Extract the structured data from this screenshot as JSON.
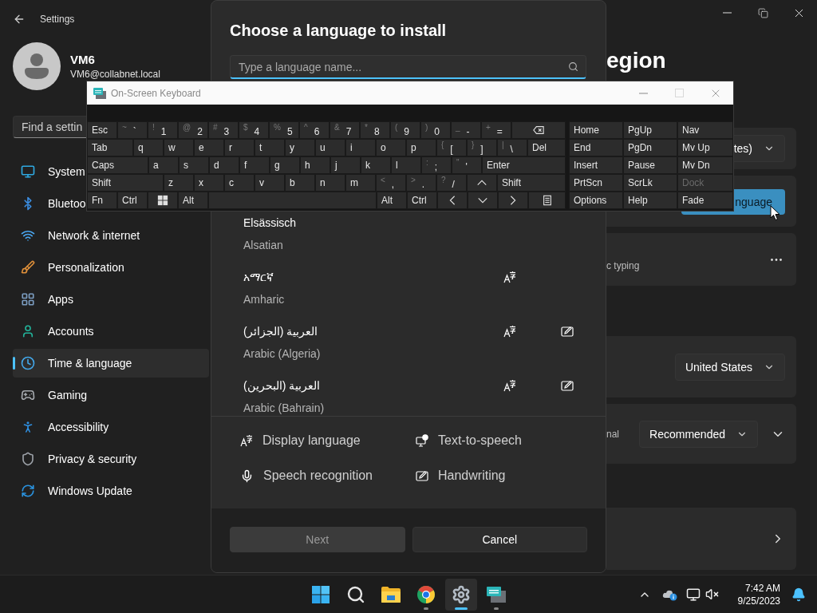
{
  "settings": {
    "title": "Settings",
    "user": {
      "name": "VM6",
      "email": "VM6@collabnet.local"
    },
    "search": {
      "placeholder": "Find a settin"
    },
    "nav": [
      {
        "label": "System",
        "kind": "system",
        "selected": false
      },
      {
        "label": "Bluetoo",
        "kind": "bluetooth",
        "selected": false
      },
      {
        "label": "Network & internet",
        "kind": "network",
        "selected": false
      },
      {
        "label": "Personalization",
        "kind": "personalization",
        "selected": false
      },
      {
        "label": "Apps",
        "kind": "apps",
        "selected": false
      },
      {
        "label": "Accounts",
        "kind": "accounts",
        "selected": false
      },
      {
        "label": "Time & language",
        "kind": "time",
        "selected": true
      },
      {
        "label": "Gaming",
        "kind": "gaming",
        "selected": false
      },
      {
        "label": "Accessibility",
        "kind": "accessibility",
        "selected": false
      },
      {
        "label": "Privacy & security",
        "kind": "privacy",
        "selected": false
      },
      {
        "label": "Windows Update",
        "kind": "update",
        "selected": false
      }
    ],
    "content": {
      "title": "egion",
      "sections": [
        {
          "cards": [
            {
              "kind": "dropdown",
              "value": "tes)"
            },
            {
              "kind": "button",
              "label": "nguage"
            },
            {
              "kind": "more",
              "description": "c typing"
            }
          ]
        },
        {
          "cards": [
            {
              "kind": "dropdown",
              "value": "United States"
            },
            {
              "kind": "dropdown",
              "value": "Recommended",
              "description": "nal",
              "expanded": false
            }
          ]
        },
        {
          "cards": [
            {
              "kind": "link"
            }
          ]
        }
      ]
    }
  },
  "dialog": {
    "title": "Choose a language to install",
    "search": {
      "placeholder": "Type a language name..."
    },
    "languages": [
      {
        "name": "Elsässisch",
        "english": "Alsatian",
        "display_language": false,
        "handwriting": false
      },
      {
        "name": "አማርኛ",
        "english": "Amharic",
        "display_language": true,
        "handwriting": false
      },
      {
        "name": "العربية (الجزائر)",
        "english": "Arabic (Algeria)",
        "display_language": true,
        "handwriting": true
      },
      {
        "name": "العربية (البحرين)",
        "english": "Arabic (Bahrain)",
        "display_language": true,
        "handwriting": true
      }
    ],
    "legend": [
      {
        "kind": "display",
        "label": "Display language"
      },
      {
        "kind": "tts",
        "label": "Text-to-speech"
      },
      {
        "kind": "speech",
        "label": "Speech recognition"
      },
      {
        "kind": "handwriting",
        "label": "Handwriting"
      }
    ],
    "buttons": [
      {
        "label": "Next",
        "disabled": true
      },
      {
        "label": "Cancel",
        "disabled": false
      }
    ]
  },
  "keyboard": {
    "title": "On-Screen Keyboard",
    "rows": [
      {
        "keys": [
          {
            "kind": "key",
            "label": "Esc"
          },
          {
            "kind": "key",
            "shift": "~",
            "label": "`"
          },
          {
            "kind": "key",
            "shift": "!",
            "label": "1"
          },
          {
            "kind": "key",
            "shift": "@",
            "label": "2"
          },
          {
            "kind": "key",
            "shift": "#",
            "label": "3"
          },
          {
            "kind": "key",
            "shift": "$",
            "label": "4"
          },
          {
            "kind": "key",
            "shift": "%",
            "label": "5"
          },
          {
            "kind": "key",
            "shift": "^",
            "label": "6"
          },
          {
            "kind": "key",
            "shift": "&",
            "label": "7"
          },
          {
            "kind": "key",
            "shift": "*",
            "label": "8"
          },
          {
            "kind": "key",
            "shift": "(",
            "label": "9"
          },
          {
            "kind": "key",
            "shift": ")",
            "label": "0"
          },
          {
            "kind": "key",
            "shift": "_",
            "label": "-"
          },
          {
            "kind": "key",
            "shift": "+",
            "label": "="
          },
          {
            "kind": "backspace"
          }
        ]
      },
      {
        "keys": [
          {
            "kind": "tab",
            "label": "Tab"
          },
          {
            "kind": "key",
            "label": "q"
          },
          {
            "kind": "key",
            "label": "w"
          },
          {
            "kind": "key",
            "label": "e"
          },
          {
            "kind": "key",
            "label": "r"
          },
          {
            "kind": "key",
            "label": "t"
          },
          {
            "kind": "key",
            "label": "y"
          },
          {
            "kind": "key",
            "label": "u"
          },
          {
            "kind": "key",
            "label": "i"
          },
          {
            "kind": "key",
            "label": "o"
          },
          {
            "kind": "key",
            "label": "p"
          },
          {
            "kind": "key",
            "shift": "{",
            "label": "["
          },
          {
            "kind": "key",
            "shift": "}",
            "label": "]"
          },
          {
            "kind": "key",
            "shift": "|",
            "label": "\\"
          },
          {
            "kind": "wide",
            "label": "Del"
          }
        ]
      },
      {
        "keys": [
          {
            "kind": "caps",
            "label": "Caps"
          },
          {
            "kind": "key",
            "label": "a"
          },
          {
            "kind": "key",
            "label": "s"
          },
          {
            "kind": "key",
            "label": "d"
          },
          {
            "kind": "key",
            "label": "f"
          },
          {
            "kind": "key",
            "label": "g"
          },
          {
            "kind": "key",
            "label": "h"
          },
          {
            "kind": "key",
            "label": "j"
          },
          {
            "kind": "key",
            "label": "k"
          },
          {
            "kind": "key",
            "label": "l"
          },
          {
            "kind": "key",
            "shift": ":",
            "label": ";"
          },
          {
            "kind": "key",
            "shift": "\"",
            "label": "'"
          },
          {
            "kind": "wide",
            "label": "Enter"
          }
        ]
      },
      {
        "keys": [
          {
            "kind": "shift",
            "label": "Shift"
          },
          {
            "kind": "key",
            "label": "z"
          },
          {
            "kind": "key",
            "label": "x"
          },
          {
            "kind": "key",
            "label": "c"
          },
          {
            "kind": "key",
            "label": "v"
          },
          {
            "kind": "key",
            "label": "b"
          },
          {
            "kind": "key",
            "label": "n"
          },
          {
            "kind": "key",
            "label": "m"
          },
          {
            "kind": "key",
            "shift": "<",
            "label": ","
          },
          {
            "kind": "key",
            "shift": ">",
            "label": "."
          },
          {
            "kind": "key",
            "shift": "?",
            "label": "/"
          },
          {
            "kind": "up"
          },
          {
            "kind": "wide",
            "label": "Shift"
          }
        ]
      },
      {
        "keys": [
          {
            "kind": "key",
            "label": "Fn"
          },
          {
            "kind": "key",
            "label": "Ctrl"
          },
          {
            "kind": "windows"
          },
          {
            "kind": "key",
            "label": "Alt"
          },
          {
            "kind": "space"
          },
          {
            "kind": "key",
            "label": "Alt"
          },
          {
            "kind": "key",
            "label": "Ctrl"
          },
          {
            "kind": "left"
          },
          {
            "kind": "down"
          },
          {
            "kind": "right"
          },
          {
            "kind": "menu"
          }
        ]
      }
    ],
    "nav_keys": [
      {
        "label": "Home",
        "disabled": false
      },
      {
        "label": "PgUp",
        "disabled": false
      },
      {
        "label": "Nav",
        "disabled": false
      },
      {
        "label": "End",
        "disabled": false
      },
      {
        "label": "PgDn",
        "disabled": false
      },
      {
        "label": "Mv Up",
        "disabled": false
      },
      {
        "label": "Insert",
        "disabled": false
      },
      {
        "label": "Pause",
        "disabled": false
      },
      {
        "label": "Mv Dn",
        "disabled": false
      },
      {
        "label": "PrtScn",
        "disabled": false
      },
      {
        "label": "ScrLk",
        "disabled": false
      },
      {
        "label": "Dock",
        "disabled": true
      },
      {
        "label": "Options",
        "disabled": false
      },
      {
        "label": "Help",
        "disabled": false
      },
      {
        "label": "Fade",
        "disabled": false
      }
    ]
  },
  "taskbar": {
    "apps": [
      {
        "kind": "start",
        "running": false,
        "selected": false
      },
      {
        "kind": "search",
        "running": false,
        "selected": false
      },
      {
        "kind": "explorer",
        "running": false,
        "selected": false
      },
      {
        "kind": "chrome",
        "running": true,
        "selected": false
      },
      {
        "kind": "settings",
        "running": true,
        "selected": true
      },
      {
        "kind": "keyboard",
        "running": true,
        "selected": false
      }
    ],
    "time": "7:42 AM",
    "date": "9/25/2023"
  }
}
